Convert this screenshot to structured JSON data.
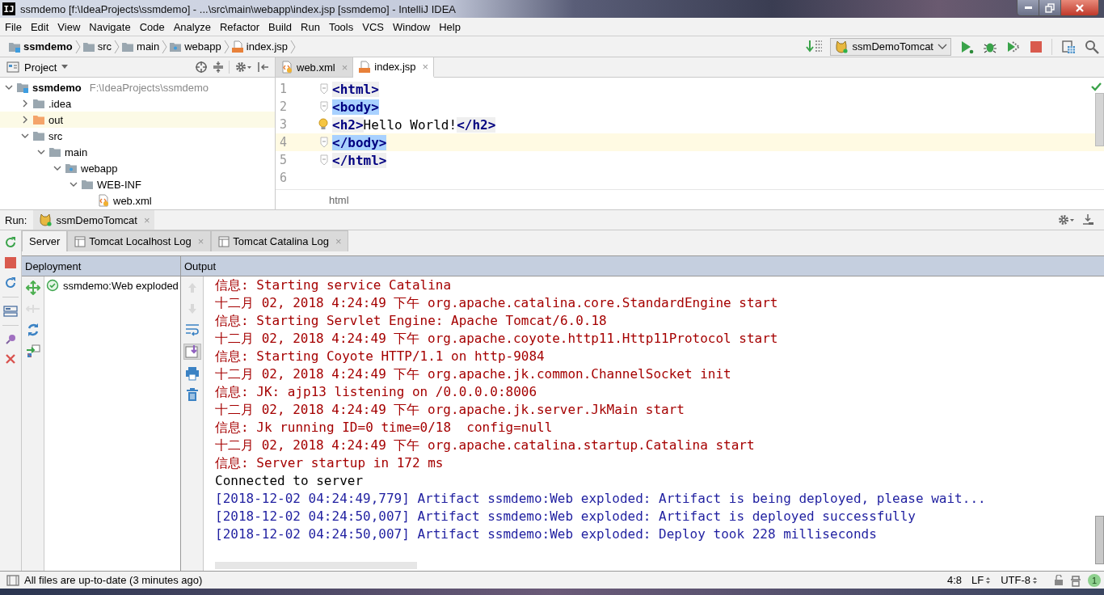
{
  "window": {
    "logo": "IJ",
    "title": "ssmdemo [f:\\IdeaProjects\\ssmdemo] - ...\\src\\main\\webapp\\index.jsp [ssmdemo] - IntelliJ IDEA"
  },
  "menu": [
    "File",
    "Edit",
    "View",
    "Navigate",
    "Code",
    "Analyze",
    "Refactor",
    "Build",
    "Run",
    "Tools",
    "VCS",
    "Window",
    "Help"
  ],
  "breadcrumbs": [
    {
      "label": "ssmdemo",
      "kind": "module"
    },
    {
      "label": "src",
      "kind": "folder"
    },
    {
      "label": "main",
      "kind": "folder"
    },
    {
      "label": "webapp",
      "kind": "web"
    },
    {
      "label": "index.jsp",
      "kind": "jsp"
    }
  ],
  "run_config": "ssmDemoTomcat",
  "project": {
    "title": "Project",
    "tree": [
      {
        "label": "ssmdemo",
        "path": "F:\\IdeaProjects\\ssmdemo",
        "kind": "module",
        "expanded": true,
        "highlighted": false,
        "children": [
          {
            "label": ".idea",
            "kind": "folder",
            "expanded": false,
            "highlighted": false
          },
          {
            "label": "out",
            "kind": "excluded",
            "expanded": false,
            "highlighted": true
          },
          {
            "label": "src",
            "kind": "folder",
            "expanded": true,
            "highlighted": false,
            "children": [
              {
                "label": "main",
                "kind": "folder",
                "expanded": true,
                "highlighted": false,
                "children": [
                  {
                    "label": "webapp",
                    "kind": "web",
                    "expanded": true,
                    "highlighted": false,
                    "children": [
                      {
                        "label": "WEB-INF",
                        "kind": "folder",
                        "expanded": true,
                        "highlighted": false,
                        "children": [
                          {
                            "label": "web.xml",
                            "kind": "xml",
                            "highlighted": false
                          }
                        ]
                      }
                    ]
                  }
                ]
              }
            ]
          }
        ]
      }
    ]
  },
  "editor": {
    "tabs": [
      {
        "label": "web.xml",
        "kind": "xml",
        "selected": false,
        "close": "×"
      },
      {
        "label": "index.jsp",
        "kind": "jsp",
        "selected": true,
        "close": "×"
      }
    ],
    "lines": [
      {
        "number": "1",
        "fold": true,
        "bulb": false,
        "current": false,
        "segments": [
          {
            "text": "<html>",
            "kind": "tag",
            "matched": false
          }
        ]
      },
      {
        "number": "2",
        "fold": true,
        "bulb": false,
        "current": false,
        "segments": [
          {
            "text": "<body>",
            "kind": "tag",
            "matched": true
          }
        ]
      },
      {
        "number": "3",
        "fold": false,
        "bulb": true,
        "current": false,
        "segments": [
          {
            "text": "<h2>",
            "kind": "tag",
            "matched": false
          },
          {
            "text": "Hello World!",
            "kind": "text"
          },
          {
            "text": "</h2>",
            "kind": "tag",
            "matched": false
          }
        ]
      },
      {
        "number": "4",
        "fold": true,
        "bulb": false,
        "current": true,
        "segments": [
          {
            "text": "</body>",
            "kind": "tag",
            "matched": true
          }
        ]
      },
      {
        "number": "5",
        "fold": true,
        "bulb": false,
        "current": false,
        "segments": [
          {
            "text": "</html>",
            "kind": "tag",
            "matched": false
          }
        ]
      },
      {
        "number": "6",
        "fold": false,
        "bulb": false,
        "current": false
      }
    ],
    "breadcrumb": "html"
  },
  "run": {
    "label": "Run:",
    "tab": {
      "label": "ssmDemoTomcat",
      "close": "×"
    },
    "sub_tabs": [
      {
        "label": "Server",
        "kind": "server",
        "selected": true
      },
      {
        "label": "Tomcat Localhost Log",
        "kind": "log",
        "selected": false,
        "close": "×"
      },
      {
        "label": "Tomcat Catalina Log",
        "kind": "log",
        "selected": false,
        "close": "×"
      }
    ],
    "deployment": {
      "title": "Deployment",
      "tools": [
        {
          "kind": "deploy",
          "disabled": false
        },
        {
          "kind": "undeploy",
          "disabled": true
        },
        {
          "kind": "redeploy",
          "disabled": false
        },
        {
          "kind": "artifact",
          "disabled": false
        }
      ],
      "items": [
        {
          "label": "ssmdemo:Web exploded",
          "deployed": true
        }
      ]
    },
    "output": {
      "title": "Output",
      "tools": [
        {
          "kind": "up",
          "disabled": true,
          "pressed": false
        },
        {
          "kind": "down",
          "disabled": true,
          "pressed": false
        },
        {
          "kind": "wrap",
          "disabled": false,
          "pressed": false
        },
        {
          "kind": "scroll-end",
          "disabled": false,
          "pressed": true
        },
        {
          "kind": "print",
          "disabled": false,
          "pressed": false
        },
        {
          "kind": "trash",
          "disabled": false,
          "pressed": false
        }
      ],
      "lines": [
        {
          "text": "信息: Starting service Catalina",
          "kind": "info"
        },
        {
          "text": "十二月 02, 2018 4:24:49 下午 org.apache.catalina.core.StandardEngine start",
          "kind": "info"
        },
        {
          "text": "信息: Starting Servlet Engine: Apache Tomcat/6.0.18",
          "kind": "info"
        },
        {
          "text": "十二月 02, 2018 4:24:49 下午 org.apache.coyote.http11.Http11Protocol start",
          "kind": "info"
        },
        {
          "text": "信息: Starting Coyote HTTP/1.1 on http-9084",
          "kind": "info"
        },
        {
          "text": "十二月 02, 2018 4:24:49 下午 org.apache.jk.common.ChannelSocket init",
          "kind": "info"
        },
        {
          "text": "信息: JK: ajp13 listening on /0.0.0.0:8006",
          "kind": "info"
        },
        {
          "text": "十二月 02, 2018 4:24:49 下午 org.apache.jk.server.JkMain start",
          "kind": "info"
        },
        {
          "text": "信息: Jk running ID=0 time=0/18  config=null",
          "kind": "info"
        },
        {
          "text": "十二月 02, 2018 4:24:49 下午 org.apache.catalina.startup.Catalina start",
          "kind": "info"
        },
        {
          "text": "信息: Server startup in 172 ms",
          "kind": "info"
        },
        {
          "text": "Connected to server",
          "kind": "plain"
        },
        {
          "text": "[2018-12-02 04:24:49,779] Artifact ssmdemo:Web exploded: Artifact is being deployed, please wait...",
          "kind": "artifact"
        },
        {
          "text": "[2018-12-02 04:24:50,007] Artifact ssmdemo:Web exploded: Artifact is deployed successfully",
          "kind": "artifact"
        },
        {
          "text": "[2018-12-02 04:24:50,007] Artifact ssmdemo:Web exploded: Deploy took 228 milliseconds",
          "kind": "artifact"
        }
      ]
    }
  },
  "status_bar": {
    "message": "All files are up-to-date (3 minutes ago)",
    "position": "4:8",
    "line_separator": "LF",
    "encoding": "UTF-8",
    "notifications": "1"
  }
}
